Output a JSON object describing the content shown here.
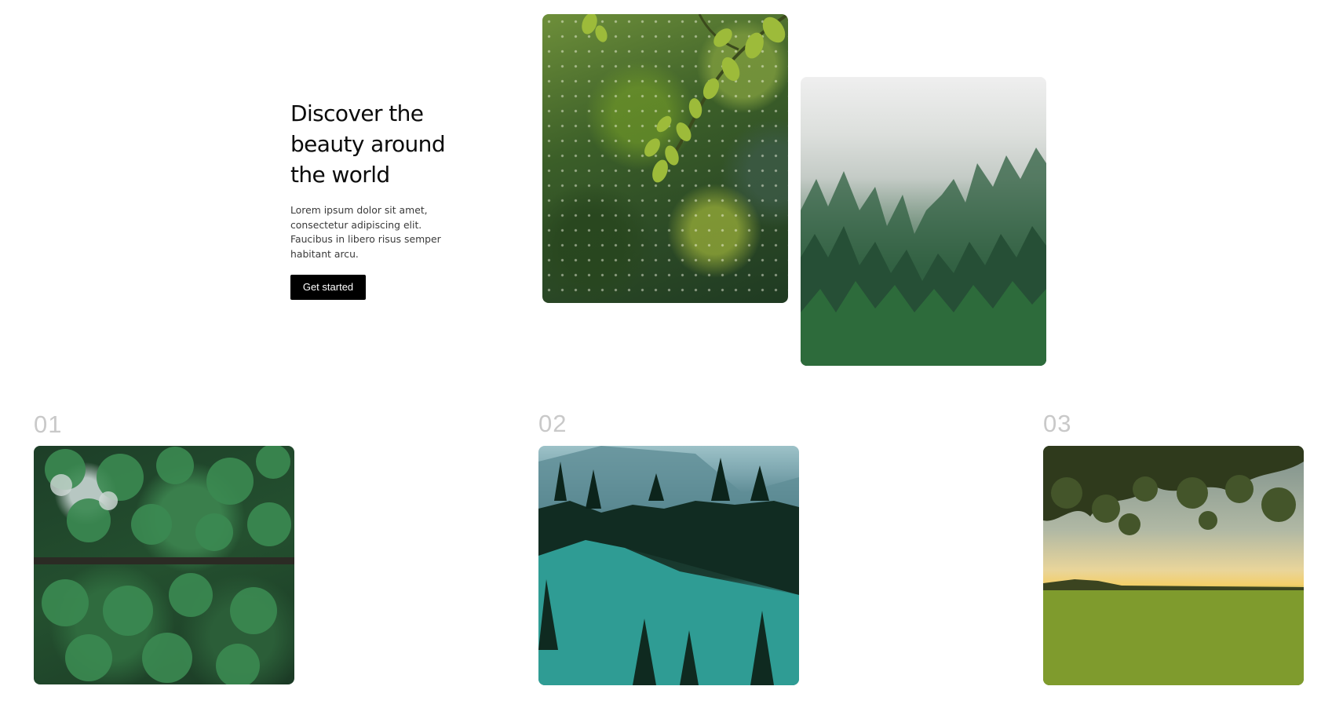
{
  "hero": {
    "title_line_1": "Discover the",
    "title_line_2": "beauty around",
    "title_line_3": "the world",
    "body": "Lorem ipsum dolor sit amet, consectetur adipiscing elit. Faucibus in libero risus semper habitant arcu.",
    "cta_label": "Get started"
  },
  "gallery": {
    "items": [
      {
        "number": "01"
      },
      {
        "number": "02"
      },
      {
        "number": "03"
      }
    ]
  },
  "colors": {
    "background": "#ffffff",
    "button": "#000000",
    "button_text": "#ffffff",
    "number": "#c9c9c9"
  }
}
